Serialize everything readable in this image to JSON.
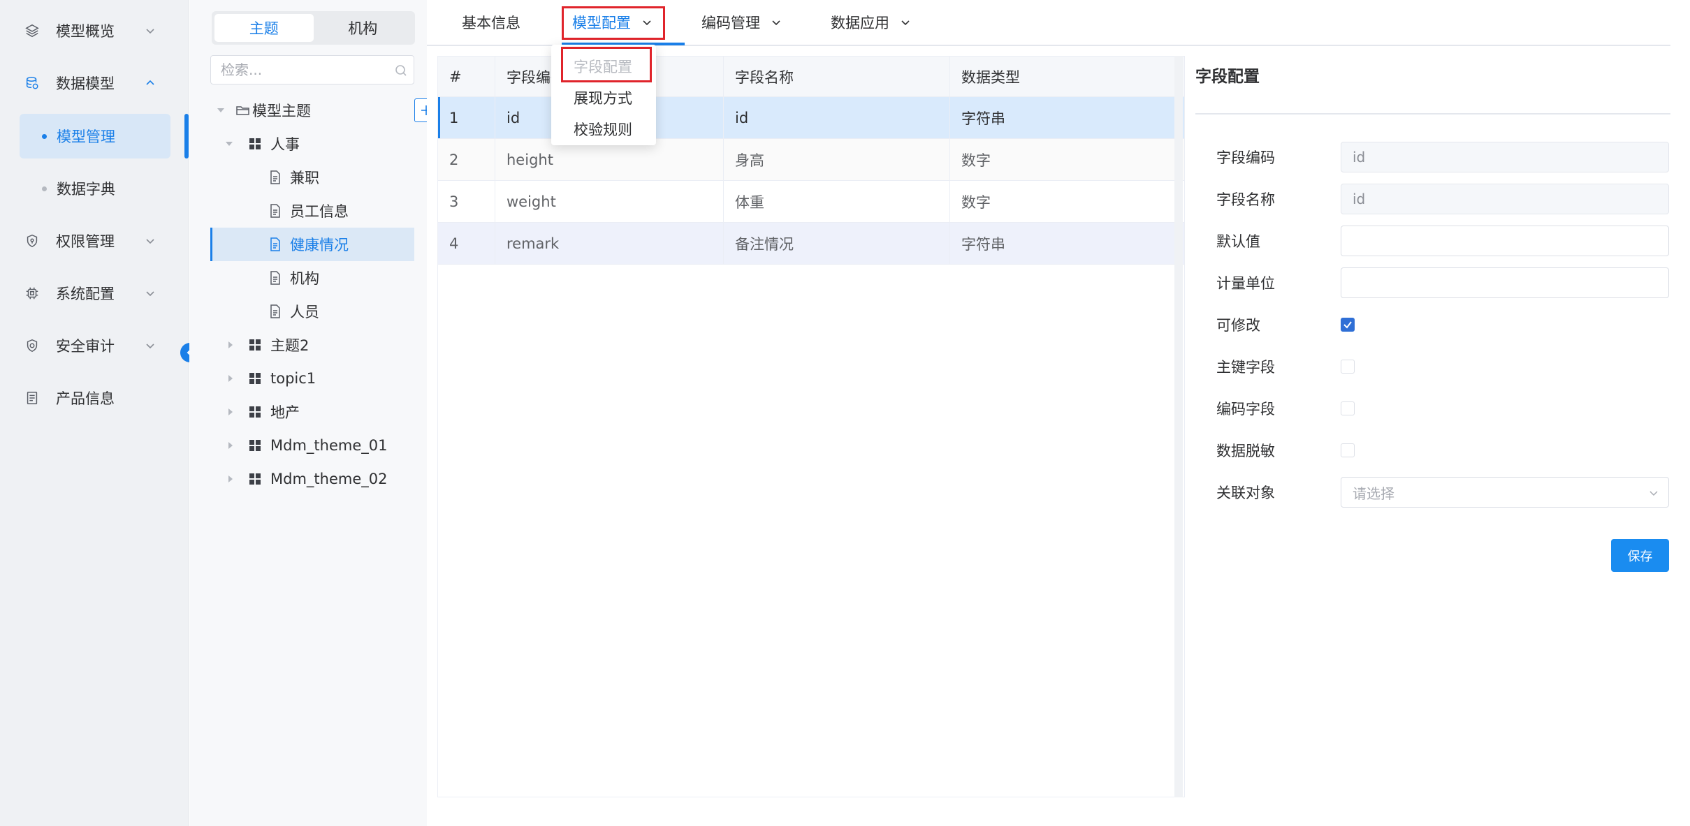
{
  "sidebar": {
    "items": [
      {
        "label": "模型概览",
        "icon": "layers-icon"
      },
      {
        "label": "数据模型",
        "icon": "database-icon",
        "expanded": true,
        "children": [
          {
            "label": "模型管理",
            "active": true
          },
          {
            "label": "数据字典"
          }
        ]
      },
      {
        "label": "权限管理",
        "icon": "shield-icon"
      },
      {
        "label": "系统配置",
        "icon": "chip-icon"
      },
      {
        "label": "安全审计",
        "icon": "audit-shield-icon"
      },
      {
        "label": "产品信息",
        "icon": "document-list-icon"
      }
    ]
  },
  "tree": {
    "segments": [
      "主题",
      "机构"
    ],
    "active_segment": 0,
    "search_placeholder": "检索...",
    "root": "模型主题",
    "nodes": [
      {
        "label": "人事",
        "level": 1,
        "type": "grid",
        "expanded": true
      },
      {
        "label": "兼职",
        "level": 2,
        "type": "doc"
      },
      {
        "label": "员工信息",
        "level": 2,
        "type": "doc"
      },
      {
        "label": "健康情况",
        "level": 2,
        "type": "doc",
        "selected": true
      },
      {
        "label": "机构",
        "level": 2,
        "type": "doc"
      },
      {
        "label": "人员",
        "level": 2,
        "type": "doc"
      },
      {
        "label": "主题2",
        "level": 1,
        "type": "grid"
      },
      {
        "label": "topic1",
        "level": 1,
        "type": "grid"
      },
      {
        "label": "地产",
        "level": 1,
        "type": "grid"
      },
      {
        "label": "Mdm_theme_01",
        "level": 1,
        "type": "grid"
      },
      {
        "label": "Mdm_theme_02",
        "level": 1,
        "type": "grid"
      }
    ]
  },
  "tabs": [
    {
      "label": "基本信息",
      "dropdown": false
    },
    {
      "label": "模型配置",
      "dropdown": true,
      "active": true
    },
    {
      "label": "编码管理",
      "dropdown": true
    },
    {
      "label": "数据应用",
      "dropdown": true
    }
  ],
  "dropdown_menu": {
    "items": [
      {
        "label": "字段配置",
        "disabled": true
      },
      {
        "label": "展现方式"
      },
      {
        "label": "校验规则"
      }
    ]
  },
  "table": {
    "columns": [
      "#",
      "字段编码",
      "字段名称",
      "数据类型"
    ],
    "rows": [
      [
        "1",
        "id",
        "id",
        "字符串"
      ],
      [
        "2",
        "height",
        "身高",
        "数字"
      ],
      [
        "3",
        "weight",
        "体重",
        "数字"
      ],
      [
        "4",
        "remark",
        "备注情况",
        "字符串"
      ]
    ]
  },
  "detail": {
    "title": "字段配置",
    "fields": {
      "code_label": "字段编码",
      "code_value": "id",
      "name_label": "字段名称",
      "name_value": "id",
      "default_label": "默认值",
      "default_value": "",
      "unit_label": "计量单位",
      "unit_value": "",
      "editable_label": "可修改",
      "editable": true,
      "pk_label": "主键字段",
      "pk": false,
      "coding_label": "编码字段",
      "coding": false,
      "mask_label": "数据脱敏",
      "mask": false,
      "relation_label": "关联对象",
      "relation_placeholder": "请选择"
    },
    "save_label": "保存"
  },
  "colors": {
    "accent": "#1a7fe8",
    "highlight": "#e0242b",
    "selected_row": "#d9eafc"
  }
}
